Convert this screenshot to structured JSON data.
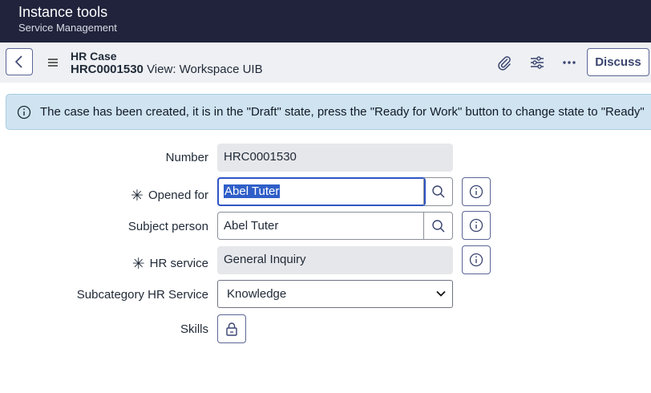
{
  "app": {
    "title": "Instance tools",
    "subtitle": "Service Management"
  },
  "header": {
    "record_type": "HR Case",
    "record_number": "HRC0001530",
    "view_label": "View: Workspace UIB",
    "discuss_label": "Discuss"
  },
  "banner": {
    "message": "The case has been created, it is in the \"Draft\" state, press the \"Ready for Work\" button to change state to \"Ready\""
  },
  "form": {
    "number": {
      "label": "Number",
      "value": "HRC0001530"
    },
    "opened_for": {
      "label": "Opened for",
      "value": "Abel Tuter",
      "required_mark": "✳"
    },
    "subject_person": {
      "label": "Subject person",
      "value": "Abel Tuter"
    },
    "hr_service": {
      "label": "HR service",
      "value": "General Inquiry",
      "required_mark": "✳"
    },
    "subcategory": {
      "label": "Subcategory HR Service",
      "value": "Knowledge"
    },
    "skills": {
      "label": "Skills"
    }
  },
  "colors": {
    "topbar": "#20233b",
    "accent": "#2f55c4",
    "banner": "#cfe4f0"
  },
  "icons": [
    "chevron-left-icon",
    "hamburger-icon",
    "paperclip-icon",
    "sliders-icon",
    "more-icon",
    "info-icon",
    "search-icon",
    "lock-icon",
    "chevron-down-icon"
  ]
}
